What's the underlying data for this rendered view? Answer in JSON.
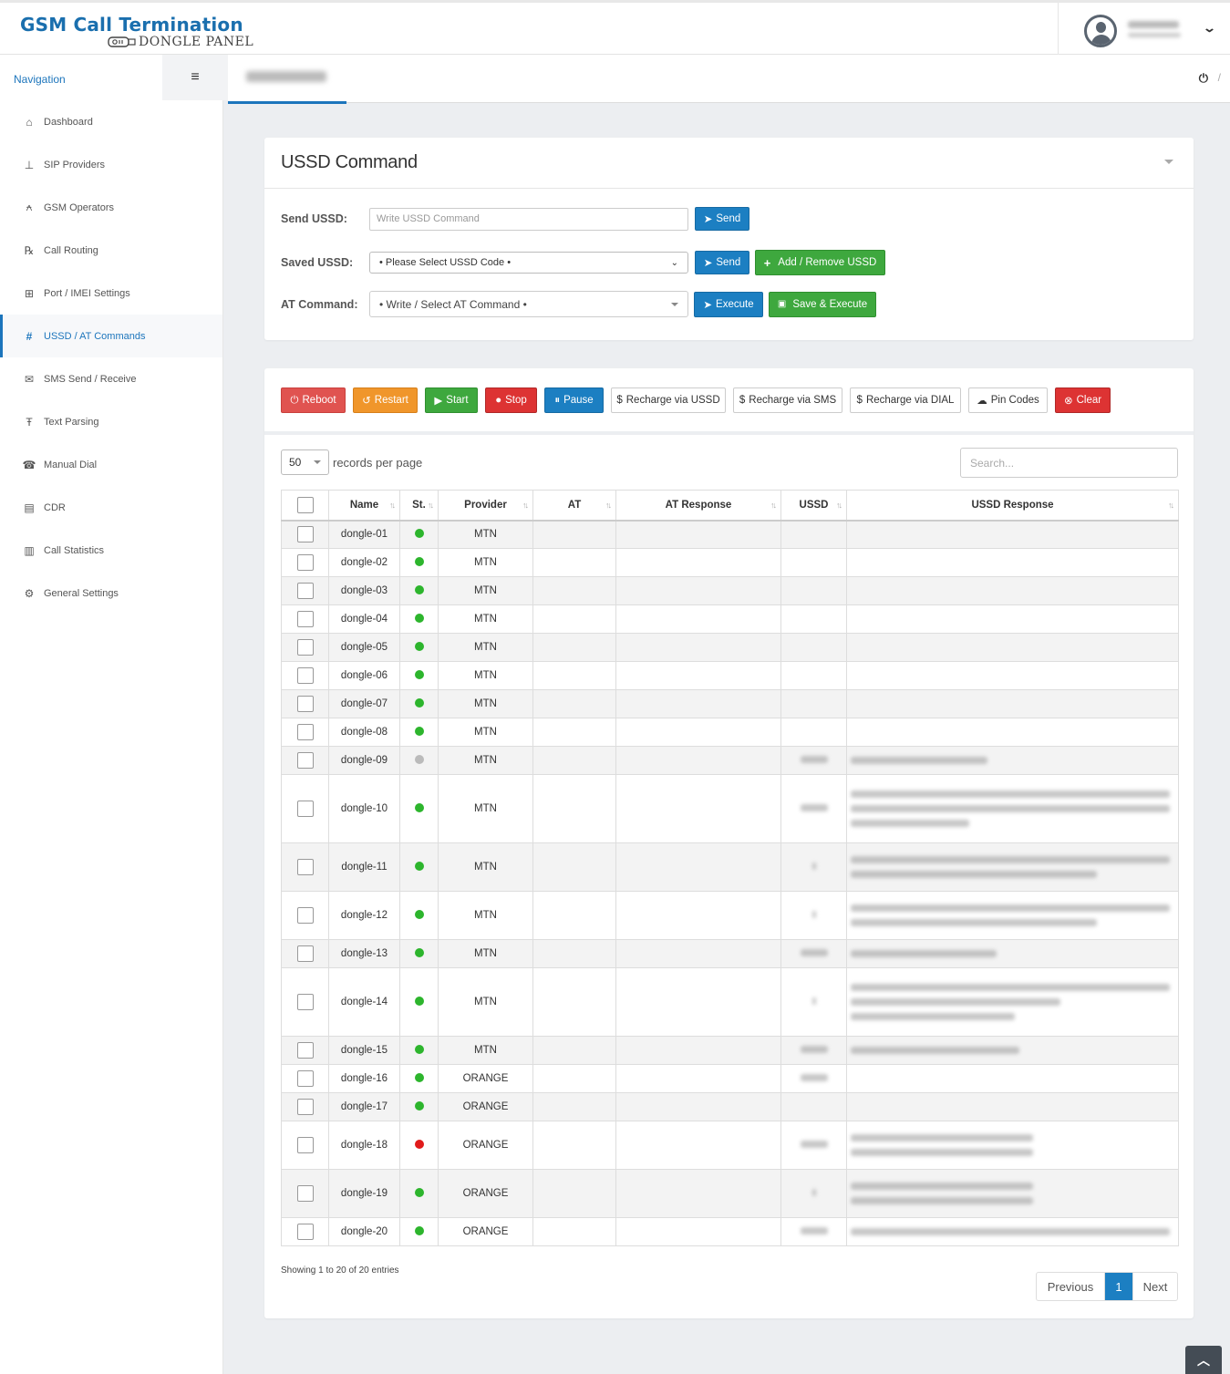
{
  "header": {
    "logo_title": "GSM Call Termination",
    "logo_subtitle": "DONGLE PANEL",
    "user_caret": "⌄"
  },
  "sidebar": {
    "title": "Navigation",
    "toggle_icon": "≡",
    "items": [
      {
        "label": "Dashboard",
        "icon": "home-icon",
        "glyph": "⌂"
      },
      {
        "label": "SIP Providers",
        "icon": "sitemap-icon",
        "glyph": "⊥"
      },
      {
        "label": "GSM Operators",
        "icon": "antenna-icon",
        "glyph": "⍲"
      },
      {
        "label": "Call Routing",
        "icon": "prescription-icon",
        "glyph": "℞"
      },
      {
        "label": "Port / IMEI Settings",
        "icon": "network-icon",
        "glyph": "⊞"
      },
      {
        "label": "USSD / AT Commands",
        "icon": "hashtag-icon",
        "glyph": "#"
      },
      {
        "label": "SMS Send / Receive",
        "icon": "comment-icon",
        "glyph": "✉"
      },
      {
        "label": "Text Parsing",
        "icon": "text-icon",
        "glyph": "Ŧ"
      },
      {
        "label": "Manual Dial",
        "icon": "dial-icon",
        "glyph": "☎"
      },
      {
        "label": "CDR",
        "icon": "table-icon",
        "glyph": "▤"
      },
      {
        "label": "Call Statistics",
        "icon": "bar-chart-icon",
        "glyph": "▥"
      },
      {
        "label": "General Settings",
        "icon": "gears-icon",
        "glyph": "⚙"
      }
    ],
    "active_index": 5
  },
  "subbar": {
    "power_icon": "⏻",
    "slash": "/"
  },
  "ussd_panel": {
    "title": "USSD Command",
    "send_ussd": {
      "label": "Send USSD:",
      "placeholder": "Write USSD Command",
      "button": "Send"
    },
    "saved_ussd": {
      "label": "Saved USSD:",
      "selected": "• Please Select USSD Code •",
      "send_button": "Send",
      "add_remove_button": "Add / Remove USSD"
    },
    "at_command": {
      "label": "AT Command:",
      "selected": "• Write / Select AT Command •",
      "execute_button": "Execute",
      "save_execute_button": "Save & Execute"
    }
  },
  "toolbar": {
    "reboot": "Reboot",
    "restart": "Restart",
    "start": "Start",
    "stop": "Stop",
    "pause": "Pause",
    "recharge_ussd": "Recharge via USSD",
    "recharge_sms": "Recharge via SMS",
    "recharge_dial": "Recharge via DIAL",
    "pin_codes": "Pin Codes",
    "clear": "Clear"
  },
  "table_controls": {
    "page_length": "50",
    "records_per_page": "records per page",
    "search_placeholder": "Search..."
  },
  "table": {
    "columns": [
      "Name",
      "St.",
      "Provider",
      "AT",
      "AT Response",
      "USSD",
      "USSD Response"
    ],
    "status_colors": {
      "green": "#2db52d",
      "gray": "#bbbbbb",
      "red": "#e11b1b"
    },
    "rows": [
      {
        "name": "dongle-01",
        "status": "green",
        "provider": "MTN",
        "ussd_lines": 0,
        "resp_lines": 0
      },
      {
        "name": "dongle-02",
        "status": "green",
        "provider": "MTN",
        "ussd_lines": 0,
        "resp_lines": 0
      },
      {
        "name": "dongle-03",
        "status": "green",
        "provider": "MTN",
        "ussd_lines": 0,
        "resp_lines": 0
      },
      {
        "name": "dongle-04",
        "status": "green",
        "provider": "MTN",
        "ussd_lines": 0,
        "resp_lines": 0
      },
      {
        "name": "dongle-05",
        "status": "green",
        "provider": "MTN",
        "ussd_lines": 0,
        "resp_lines": 0
      },
      {
        "name": "dongle-06",
        "status": "green",
        "provider": "MTN",
        "ussd_lines": 0,
        "resp_lines": 0
      },
      {
        "name": "dongle-07",
        "status": "green",
        "provider": "MTN",
        "ussd_lines": 0,
        "resp_lines": 0
      },
      {
        "name": "dongle-08",
        "status": "green",
        "provider": "MTN",
        "ussd_lines": 0,
        "resp_lines": 0
      },
      {
        "name": "dongle-09",
        "status": "gray",
        "provider": "MTN",
        "ussd_lines": 1,
        "resp_lines": 1
      },
      {
        "name": "dongle-10",
        "status": "green",
        "provider": "MTN",
        "ussd_lines": 1,
        "resp_lines": 3
      },
      {
        "name": "dongle-11",
        "status": "green",
        "provider": "MTN",
        "ussd_lines": 1,
        "resp_lines": 2
      },
      {
        "name": "dongle-12",
        "status": "green",
        "provider": "MTN",
        "ussd_lines": 1,
        "resp_lines": 2
      },
      {
        "name": "dongle-13",
        "status": "green",
        "provider": "MTN",
        "ussd_lines": 1,
        "resp_lines": 1
      },
      {
        "name": "dongle-14",
        "status": "green",
        "provider": "MTN",
        "ussd_lines": 1,
        "resp_lines": 3
      },
      {
        "name": "dongle-15",
        "status": "green",
        "provider": "MTN",
        "ussd_lines": 1,
        "resp_lines": 1
      },
      {
        "name": "dongle-16",
        "status": "green",
        "provider": "ORANGE",
        "ussd_lines": 1,
        "resp_lines": 0
      },
      {
        "name": "dongle-17",
        "status": "green",
        "provider": "ORANGE",
        "ussd_lines": 0,
        "resp_lines": 0
      },
      {
        "name": "dongle-18",
        "status": "red",
        "provider": "ORANGE",
        "ussd_lines": 1,
        "resp_lines": 2
      },
      {
        "name": "dongle-19",
        "status": "green",
        "provider": "ORANGE",
        "ussd_lines": 1,
        "resp_lines": 2
      },
      {
        "name": "dongle-20",
        "status": "green",
        "provider": "ORANGE",
        "ussd_lines": 1,
        "resp_lines": 1
      }
    ]
  },
  "footer": {
    "info": "Showing 1 to 20 of 20 entries",
    "previous": "Previous",
    "current_page": "1",
    "next": "Next"
  },
  "back_to_top_icon": "︿"
}
